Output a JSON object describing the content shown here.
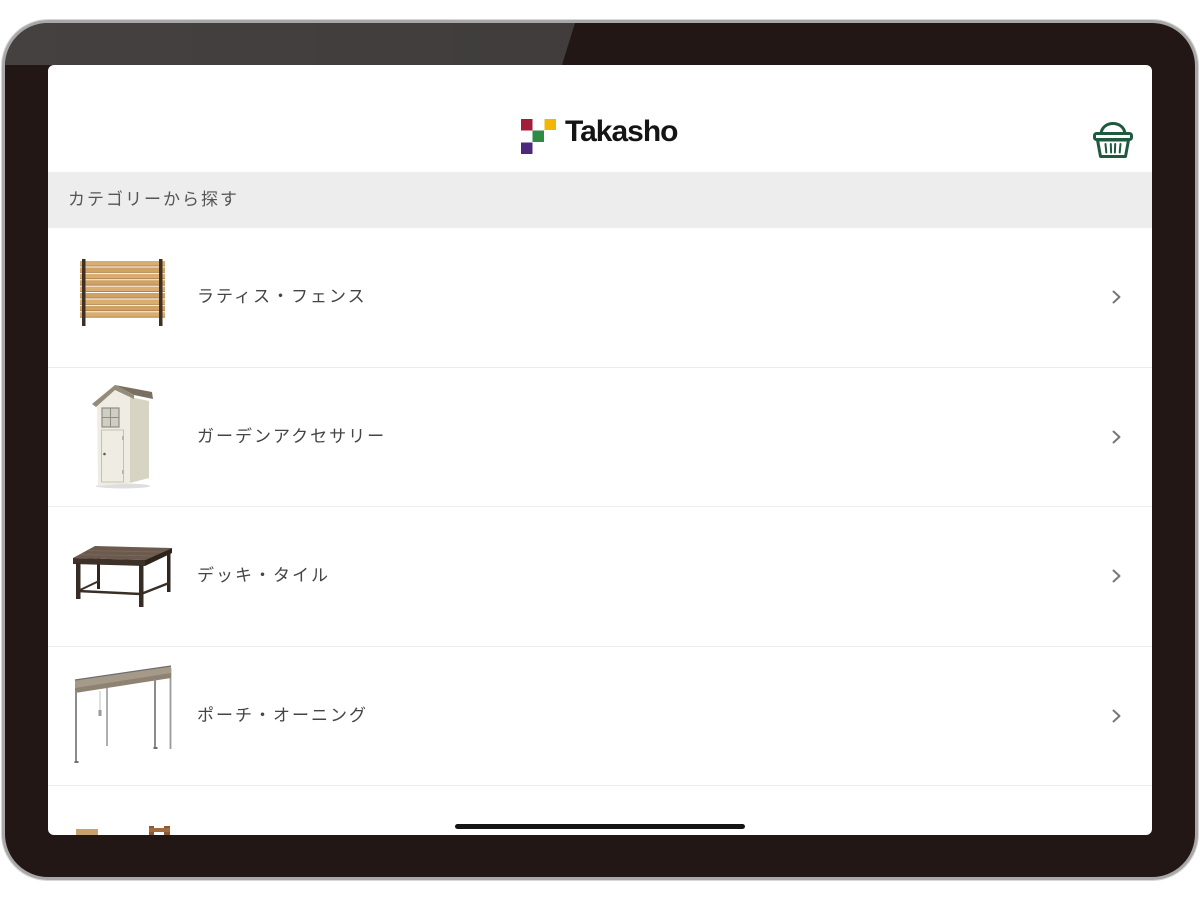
{
  "header": {
    "brand": "Takasho",
    "logo_colors": [
      "#a21d3a",
      "#f2b705",
      "#2f8b44",
      "#4b2a7d"
    ],
    "cart_icon": "basket-icon",
    "accent_color": "#1f5a3f"
  },
  "section": {
    "title": "カテゴリーから探す"
  },
  "categories": [
    {
      "label": "ラティス・フェンス",
      "image": "lattice-fence-image",
      "chevron": "chevron-right-icon"
    },
    {
      "label": "ガーデンアクセサリー",
      "image": "garden-shed-image",
      "chevron": "chevron-right-icon"
    },
    {
      "label": "デッキ・タイル",
      "image": "deck-table-image",
      "chevron": "chevron-right-icon"
    },
    {
      "label": "ポーチ・オーニング",
      "image": "porch-awning-image",
      "chevron": "chevron-right-icon"
    }
  ],
  "partial_item": {
    "image": "wooden-item-image"
  },
  "colors": {
    "chevron": "#777777",
    "section_bar": "#ededed",
    "device_frame": "#221714"
  }
}
